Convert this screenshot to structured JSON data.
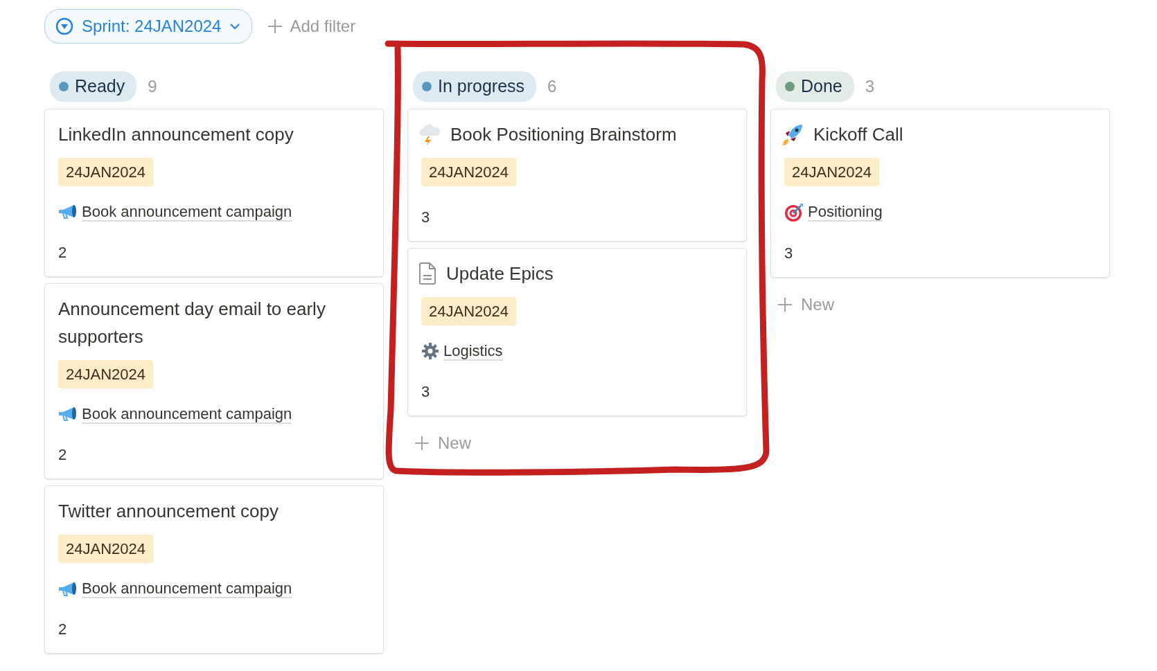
{
  "filter": {
    "label": "Sprint: 24JAN2024"
  },
  "add_filter": {
    "label": "Add filter"
  },
  "columns": [
    {
      "status": "Ready",
      "count": "9",
      "color": "#5b97bd",
      "highlighted": false,
      "cards": [
        {
          "title": "LinkedIn announcement copy",
          "kind": "plain",
          "tag": "24JAN2024",
          "relation": {
            "label": "Book announcement campaign",
            "kind": "megaphone"
          },
          "number": "2"
        },
        {
          "title": "Announcement day email to early supporters",
          "kind": "plain",
          "tag": "24JAN2024",
          "relation": {
            "label": "Book announcement campaign",
            "kind": "megaphone"
          },
          "number": "2"
        },
        {
          "title": "Twitter announcement copy",
          "kind": "plain",
          "tag": "24JAN2024",
          "relation": {
            "label": "Book announcement campaign",
            "kind": "megaphone"
          },
          "number": "2"
        }
      ]
    },
    {
      "status": "In progress",
      "count": "6",
      "color": "#5b97bd",
      "highlighted": true,
      "new_label": "New",
      "cards": [
        {
          "title": "Book Positioning Brainstorm",
          "kind": "storm",
          "tag": "24JAN2024",
          "number": "3"
        },
        {
          "title": "Update Epics",
          "kind": "document",
          "tag": "24JAN2024",
          "relation": {
            "label": "Logistics",
            "kind": "gear"
          },
          "number": "3"
        }
      ]
    },
    {
      "status": "Done",
      "count": "3",
      "color": "#6c9b7d",
      "highlighted": false,
      "new_label": "New",
      "cards": [
        {
          "title": "Kickoff Call",
          "kind": "rocket",
          "tag": "24JAN2024",
          "relation": {
            "label": "Positioning",
            "kind": "target"
          },
          "number": "3"
        }
      ]
    }
  ]
}
